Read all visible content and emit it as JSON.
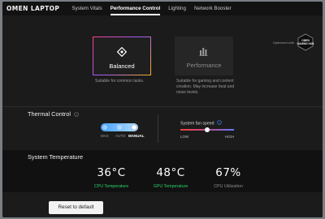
{
  "app": {
    "title": "OMEN LAPTOP"
  },
  "nav": {
    "tabs": [
      {
        "label": "System Vitals",
        "active": false
      },
      {
        "label": "Performance Control",
        "active": true
      },
      {
        "label": "Lighting",
        "active": false
      },
      {
        "label": "Network Booster",
        "active": false
      }
    ]
  },
  "modes": {
    "selected": "Balanced",
    "cards": [
      {
        "label": "Balanced",
        "icon": "balanced-diamond-icon",
        "description": "Suitable for common tasks."
      },
      {
        "label": "Performance",
        "icon": "performance-bars-icon",
        "description": "Suitable for gaming and content creation. May increase heat and noise levels."
      }
    ],
    "optimized_label": "Optimized with",
    "badge_text": "OMEN GAMING HUB"
  },
  "thermal": {
    "title": "Thermal Control",
    "options": [
      "MAX",
      "AUTO",
      "MANUAL"
    ],
    "selected": "MANUAL",
    "fan": {
      "label": "System fan speed",
      "low": "LOW",
      "high": "HIGH",
      "level": 0.5
    }
  },
  "system_temperature": {
    "title": "System Temperature",
    "readings": [
      {
        "value": "36°C",
        "label": "CPU Temperature",
        "color": "#2bd46b"
      },
      {
        "value": "48°C",
        "label": "GPU Temperature",
        "color": "#2bd46b"
      },
      {
        "value": "67%",
        "label": "CPU Utilization",
        "color": "#8e8e8e"
      }
    ]
  },
  "footer": {
    "reset_label": "Reset to default"
  },
  "colors": {
    "accent_blue": "#46a1ff",
    "selected_gradient": [
      "#ff3d8c",
      "#a15cff",
      "#ffb020"
    ]
  }
}
